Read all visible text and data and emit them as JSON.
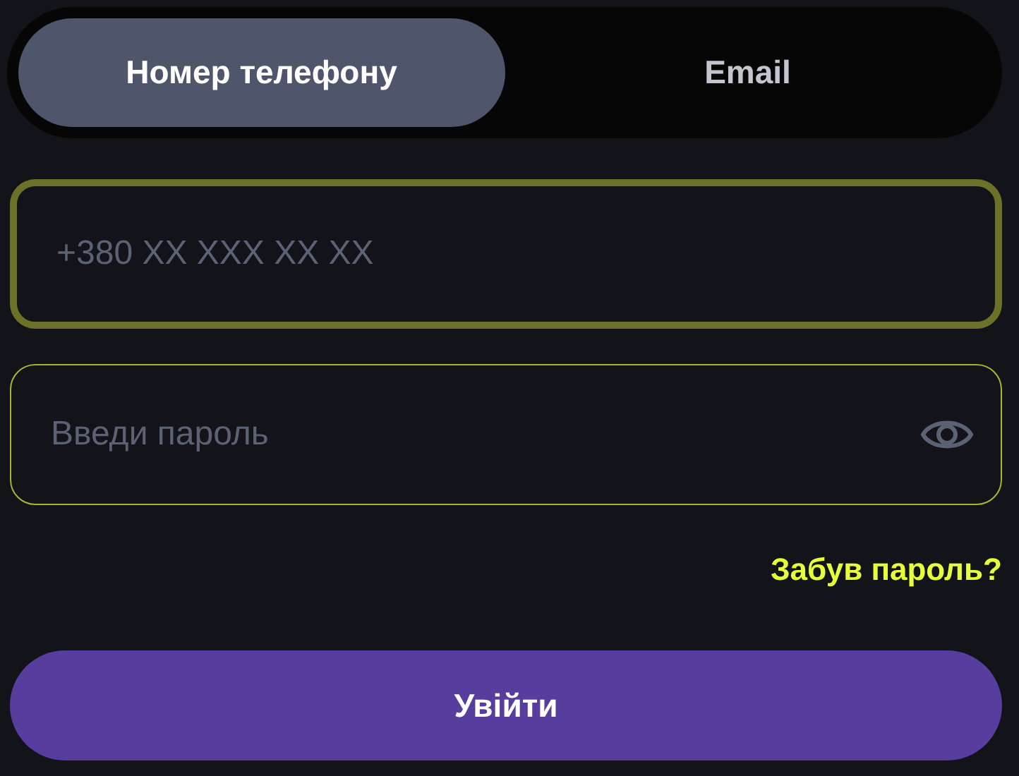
{
  "tabs": [
    {
      "label": "Номер телефону",
      "selected": true
    },
    {
      "label": "Email",
      "selected": false
    }
  ],
  "phone_field": {
    "placeholder": "+380 XX XXX XX XX",
    "focused": true
  },
  "password_field": {
    "placeholder": "Введи пароль",
    "focused": false
  },
  "forgot_link": "Забув пароль?",
  "login_button": "Увійти"
}
